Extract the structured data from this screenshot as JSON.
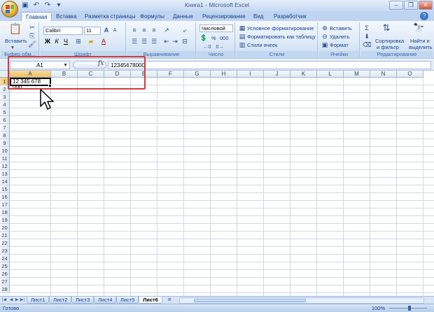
{
  "window": {
    "title": "Книга1 - Microsoft Excel",
    "controls": [
      "–",
      "❐",
      "✕"
    ]
  },
  "ribbon": {
    "tabs": [
      "Главная",
      "Вставка",
      "Разметка страницы",
      "Формулы",
      "Данные",
      "Рецензирование",
      "Вид",
      "Разработчик"
    ],
    "active_tab": "Главная",
    "clipboard": {
      "paste_label": "Вставить",
      "group_label": "Буфер обм..."
    },
    "font": {
      "name": "Calibri",
      "size": "11",
      "group_label": "Шрифт"
    },
    "alignment": {
      "group_label": "Выравнивание"
    },
    "number": {
      "format": "Числовой",
      "group_label": "Число",
      "percent": "%",
      "thousands": "000"
    },
    "styles": {
      "conditional": "Условное форматирование",
      "as_table": "Форматировать как таблицу",
      "cell_styles": "Стили ячеек",
      "group_label": "Стили"
    },
    "cells": {
      "insert": "Вставить",
      "delete": "Удалить",
      "format": "Формат",
      "group_label": "Ячейки"
    },
    "editing": {
      "sort": "Сортировка",
      "sort2": "и фильтр",
      "find": "Найти и",
      "find2": "выделить",
      "group_label": "Редактирование"
    }
  },
  "formula_bar": {
    "name_box": "A1",
    "fx": "fx",
    "content": "12345678000"
  },
  "grid": {
    "columns": [
      "A",
      "B",
      "C",
      "D",
      "E",
      "F",
      "G",
      "H",
      "I",
      "J",
      "K",
      "L",
      "M",
      "N",
      "O"
    ],
    "rows": [
      "1",
      "2",
      "3",
      "4",
      "5",
      "6",
      "7",
      "8",
      "9",
      "10",
      "11",
      "12",
      "13",
      "14",
      "15",
      "16",
      "17",
      "18",
      "19",
      "20",
      "21",
      "22",
      "23",
      "24",
      "25",
      "26",
      "27",
      "28"
    ],
    "active_cell_value": "12 345 678 000"
  },
  "sheets": {
    "tabs": [
      "Лист1",
      "Лист2",
      "Лист3",
      "Лист4",
      "Лист5",
      "Лист6"
    ],
    "active": "Лист6"
  },
  "status": {
    "ready": "Готово",
    "zoom": "100%"
  },
  "colors": {
    "callout": "#d63a3a",
    "ribbon_text": "#15428b"
  }
}
